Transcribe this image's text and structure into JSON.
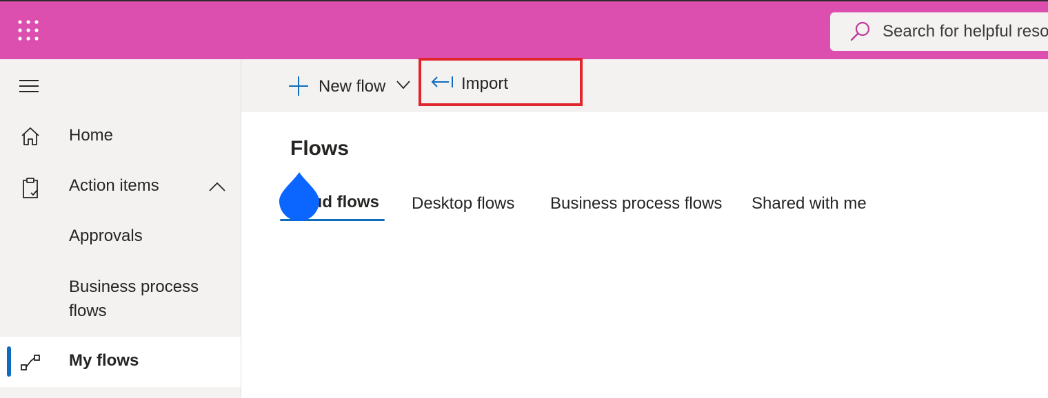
{
  "header": {
    "app_launcher_icon": "waffle-grid-icon",
    "search": {
      "placeholder": "Search for helpful resources",
      "icon": "search-icon"
    },
    "colors": {
      "bar": "#dd4fae",
      "search_bg": "#f3f2f1"
    }
  },
  "sidebar": {
    "menu_icon": "hamburger-menu-icon",
    "items": [
      {
        "label": "Home",
        "icon": "home-icon"
      },
      {
        "label": "Action items",
        "icon": "clipboard-check-icon",
        "expanded": true
      },
      {
        "label": "Approvals"
      },
      {
        "label": "Business process flows"
      },
      {
        "label": "My flows",
        "icon": "flow-icon",
        "selected": true
      }
    ]
  },
  "commandbar": {
    "new_flow_label": "New flow",
    "import_label": "Import",
    "import_highlight_color": "#e0262c"
  },
  "main": {
    "title": "Flows",
    "tabs": [
      {
        "label": "Cloud flows",
        "active": true
      },
      {
        "label": "Desktop flows"
      },
      {
        "label": "Business process flows"
      },
      {
        "label": "Shared with me"
      }
    ],
    "accent_color": "#0f6cbd"
  }
}
